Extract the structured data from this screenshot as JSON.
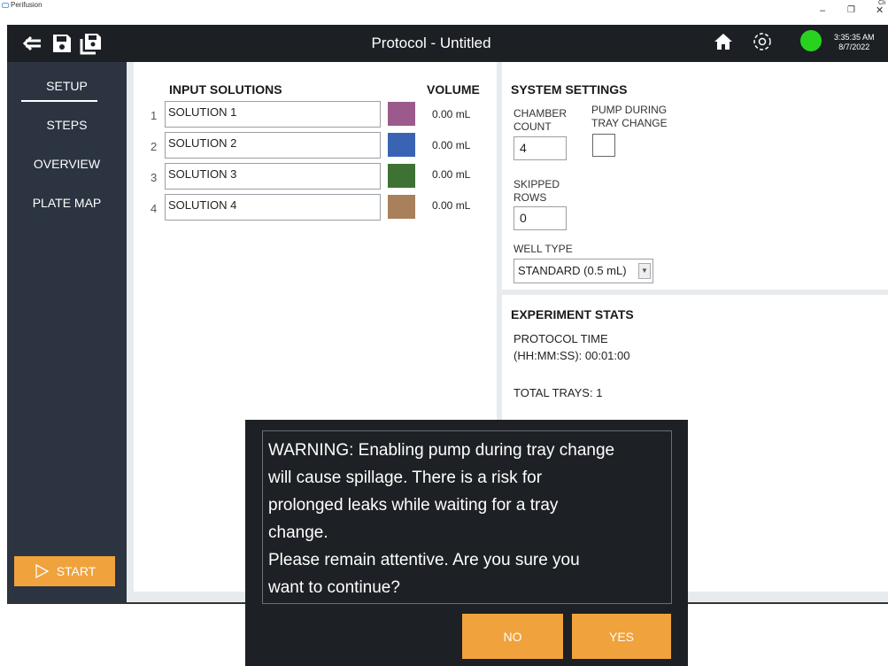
{
  "window": {
    "app_name": "Perifusion",
    "minimize": "–",
    "restore": "❐",
    "close": "✕",
    "clip_text": "Cli"
  },
  "header": {
    "title": "Protocol - Untitled",
    "time": "3:35:35 AM",
    "date": "8/7/2022",
    "status_color": "#28d320"
  },
  "sidebar": {
    "items": [
      {
        "label": "SETUP",
        "active": true
      },
      {
        "label": "STEPS"
      },
      {
        "label": "OVERVIEW"
      },
      {
        "label": "PLATE MAP"
      }
    ],
    "start_label": "START"
  },
  "input_solutions": {
    "heading": "INPUT SOLUTIONS",
    "volume_heading": "VOLUME",
    "rows": [
      {
        "num": "1",
        "name": "SOLUTION 1",
        "color": "#9c5a8c",
        "volume": "0.00 mL"
      },
      {
        "num": "2",
        "name": "SOLUTION 2",
        "color": "#3a64b3",
        "volume": "0.00 mL"
      },
      {
        "num": "3",
        "name": "SOLUTION 3",
        "color": "#3e7234",
        "volume": "0.00 mL"
      },
      {
        "num": "4",
        "name": "SOLUTION 4",
        "color": "#a8805c",
        "volume": "0.00 mL"
      }
    ]
  },
  "system_settings": {
    "heading": "SYSTEM SETTINGS",
    "chamber_count_label_1": "CHAMBER",
    "chamber_count_label_2": "COUNT",
    "chamber_count_value": "4",
    "pump_label_1": "PUMP DURING",
    "pump_label_2": "TRAY CHANGE",
    "skipped_rows_label_1": "SKIPPED",
    "skipped_rows_label_2": "ROWS",
    "skipped_rows_value": "0",
    "well_type_label": "WELL TYPE",
    "well_type_value": "STANDARD (0.5 mL)"
  },
  "experiment_stats": {
    "heading": "EXPERIMENT STATS",
    "protocol_time_label": "PROTOCOL TIME",
    "protocol_time_value": "(HH:MM:SS): 00:01:00",
    "total_trays": "TOTAL TRAYS: 1"
  },
  "dialog": {
    "line1": "WARNING: Enabling pump during tray change",
    "line2": "will cause spillage.  There is a risk for",
    "line3": "prolonged leaks while waiting for a tray",
    "line4": "change.",
    "line5": "Please remain attentive.  Are you sure you",
    "line6": "want to continue?",
    "no_label": "NO",
    "yes_label": "YES"
  }
}
